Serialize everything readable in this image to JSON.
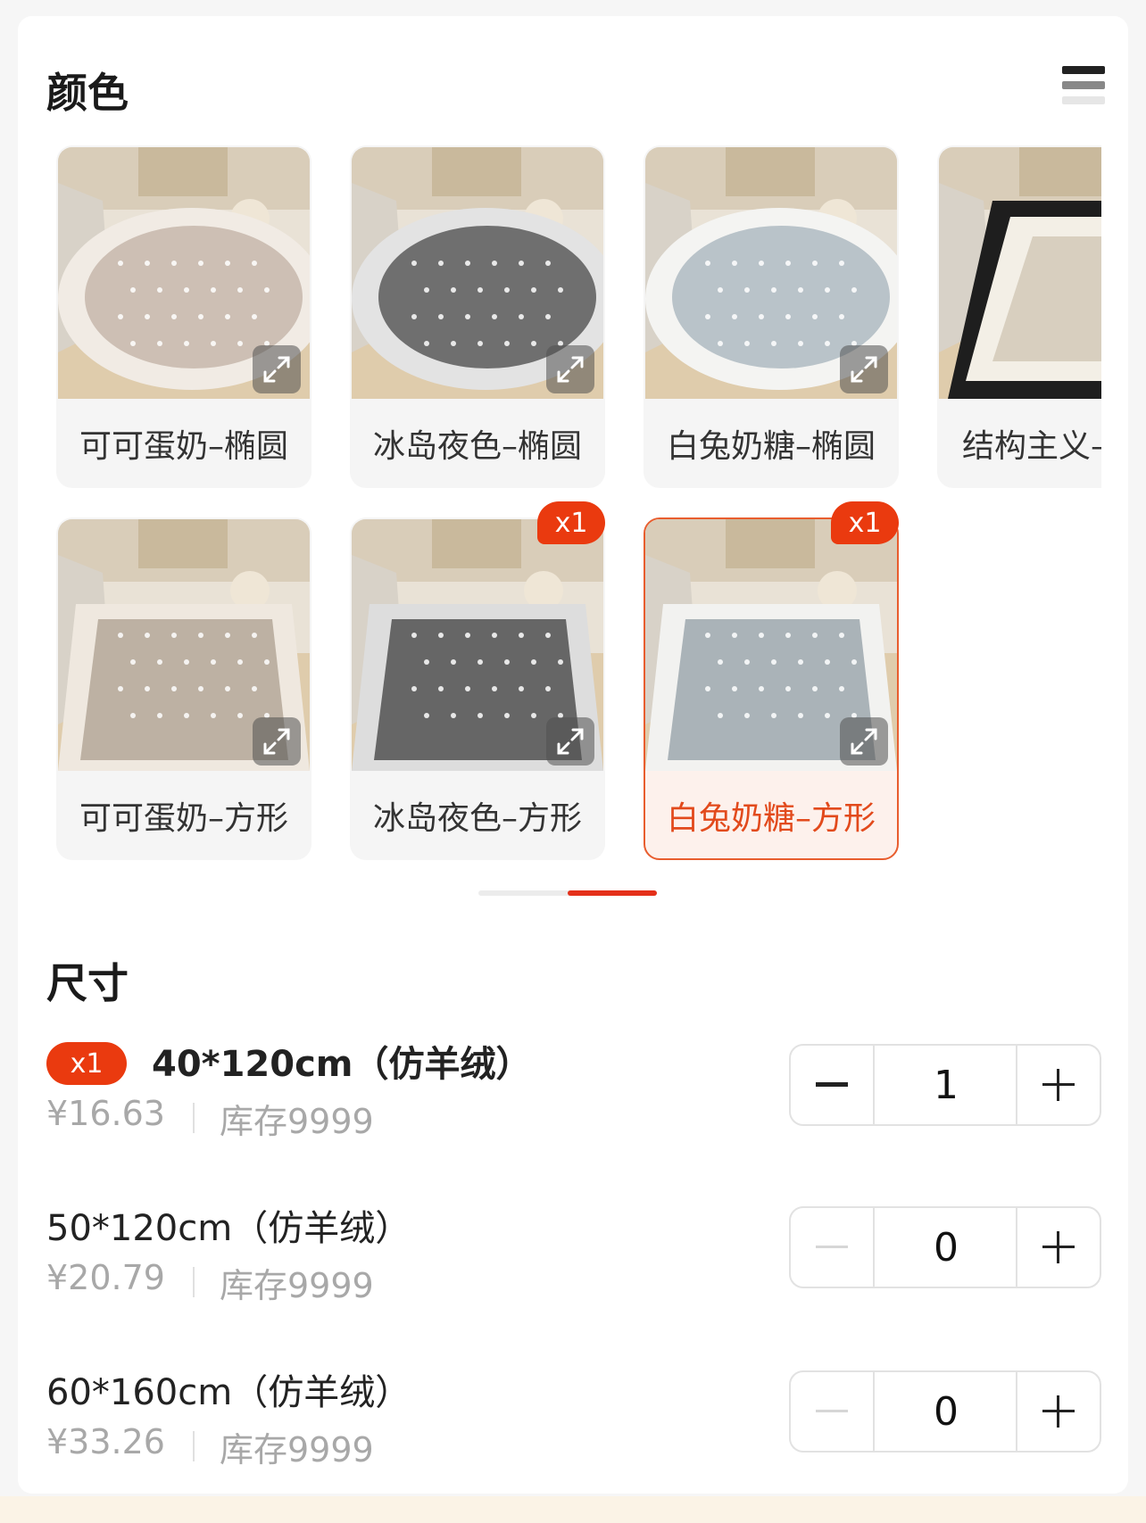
{
  "color_section": {
    "title": "颜色",
    "options": [
      {
        "label": "可可蛋奶–椭圆",
        "palette": {
          "rug": "#cdbfb4",
          "border": "#f1ebe4",
          "shape": "oval"
        },
        "selected": false,
        "badge": ""
      },
      {
        "label": "冰岛夜色–椭圆",
        "palette": {
          "rug": "#6f6f6f",
          "border": "#e3e3e3",
          "shape": "oval"
        },
        "selected": false,
        "badge": ""
      },
      {
        "label": "白兔奶糖–椭圆",
        "palette": {
          "rug": "#b9c3c9",
          "border": "#f4f4f2",
          "shape": "oval"
        },
        "selected": false,
        "badge": ""
      },
      {
        "label": "结构主义–",
        "palette": {
          "rug": "#d8cfbf",
          "border": "#1e1e1e",
          "shape": "striped"
        },
        "selected": false,
        "badge": ""
      },
      {
        "label": "可可蛋奶–方形",
        "palette": {
          "rug": "#bdb1a3",
          "border": "#efe8df",
          "shape": "rect"
        },
        "selected": false,
        "badge": ""
      },
      {
        "label": "冰岛夜色–方形",
        "palette": {
          "rug": "#666666",
          "border": "#dddddd",
          "shape": "rect"
        },
        "selected": false,
        "badge": "x1"
      },
      {
        "label": "白兔奶糖–方形",
        "palette": {
          "rug": "#aab3b8",
          "border": "#f2f2f0",
          "shape": "rect"
        },
        "selected": true,
        "badge": "x1"
      }
    ]
  },
  "size_section": {
    "title": "尺寸",
    "options": [
      {
        "name": "40*120cm（仿羊绒）",
        "price": "¥16.63",
        "stock": "库存9999",
        "quantity": "1",
        "badge": "x1",
        "minus_enabled": true
      },
      {
        "name": "50*120cm（仿羊绒）",
        "price": "¥20.79",
        "stock": "库存9999",
        "quantity": "0",
        "badge": "",
        "minus_enabled": false
      },
      {
        "name": "60*160cm（仿羊绒）",
        "price": "¥33.26",
        "stock": "库存9999",
        "quantity": "0",
        "badge": "",
        "minus_enabled": false
      }
    ]
  },
  "colors": {
    "accent": "#ea3a0f",
    "selected_text": "#e24a1c",
    "muted_text": "#a8a8a8"
  }
}
